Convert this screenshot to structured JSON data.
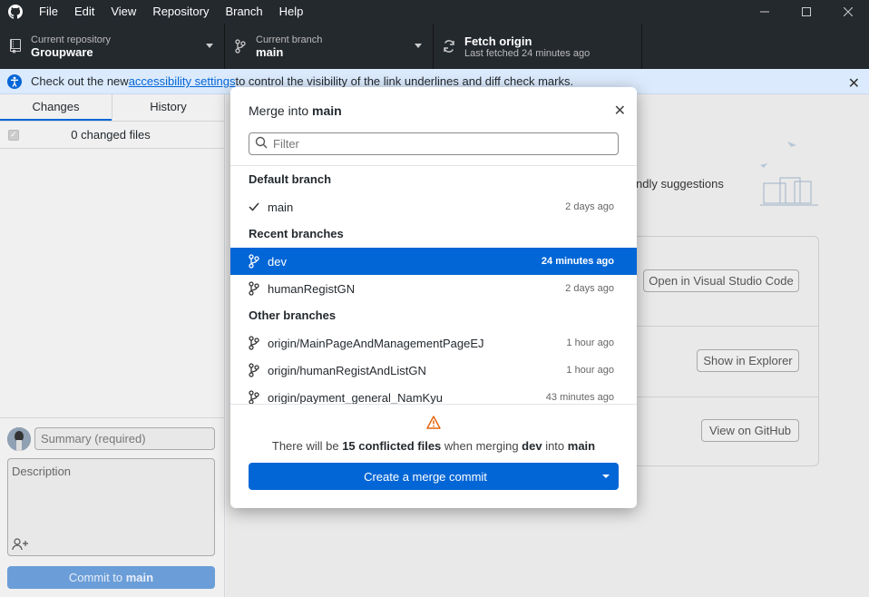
{
  "titlebar": {
    "menu": [
      "File",
      "Edit",
      "View",
      "Repository",
      "Branch",
      "Help"
    ],
    "icons": {
      "logo": "github-logo-icon",
      "minimize": "minimize-icon",
      "maximize": "maximize-icon",
      "close": "close-icon"
    }
  },
  "toolbar": {
    "repo": {
      "label": "Current repository",
      "value": "Groupware"
    },
    "branch": {
      "label": "Current branch",
      "value": "main"
    },
    "fetch": {
      "label": "Fetch origin",
      "value": "Last fetched 24 minutes ago"
    }
  },
  "banner": {
    "prefix": "Check out the new ",
    "link": "accessibility settings",
    "suffix": " to control the visibility of the link underlines and diff check marks."
  },
  "sidebar": {
    "tabs": [
      "Changes",
      "History"
    ],
    "changed_files": "0 changed files",
    "summary_placeholder": "Summary (required)",
    "description_placeholder": "Description",
    "commit_prefix": "Commit to ",
    "commit_branch": "main"
  },
  "main": {
    "suggestions_text": "ndly suggestions",
    "buttons": {
      "vscode": "Open in Visual Studio Code",
      "explorer": "Show in Explorer",
      "github": "View on GitHub"
    }
  },
  "dialog": {
    "title_prefix": "Merge into ",
    "title_branch": "main",
    "filter_placeholder": "Filter",
    "groups": {
      "default": "Default branch",
      "recent": "Recent branches",
      "other": "Other branches"
    },
    "default_branches": [
      {
        "name": "main",
        "time": "2 days ago"
      }
    ],
    "recent_branches": [
      {
        "name": "dev",
        "time": "24 minutes ago"
      },
      {
        "name": "humanRegistGN",
        "time": "2 days ago"
      }
    ],
    "other_branches": [
      {
        "name": "origin/MainPageAndManagementPageEJ",
        "time": "1 hour ago"
      },
      {
        "name": "origin/humanRegistAndListGN",
        "time": "1 hour ago"
      },
      {
        "name": "origin/payment_general_NamKyu",
        "time": "43 minutes ago"
      }
    ],
    "warning": {
      "pre": "There will be ",
      "count": "15 conflicted files",
      "mid": " when merging ",
      "source": "dev",
      "into": " into ",
      "target": "main"
    },
    "merge_button": "Create a merge commit"
  },
  "colors": {
    "accent": "#0366d6",
    "chrome": "#24292e",
    "warning": "#e36209"
  }
}
